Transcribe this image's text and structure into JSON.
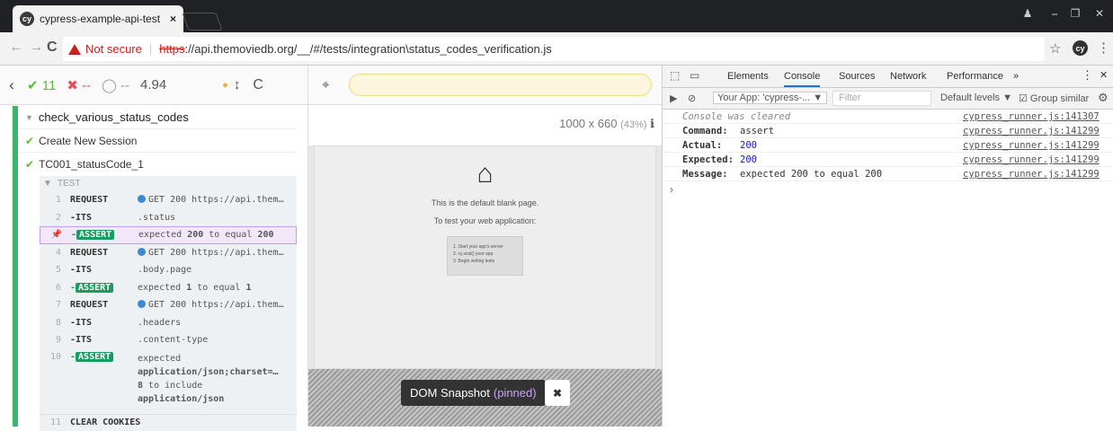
{
  "browser": {
    "tab_title": "cypress-example-api-test",
    "tab_close": "×",
    "favicon_text": "cy",
    "window_controls": [
      "⎯",
      "❐",
      "✕"
    ],
    "nav": {
      "back": "←",
      "forward": "→",
      "reload": "C"
    },
    "not_secure": "Not secure",
    "separator": "|",
    "url_scheme": "https",
    "url_rest": "://api.themoviedb.org/__/#/tests/integration\\status_codes_verification.js",
    "star": "☆",
    "ext_text": "cy",
    "menu": "⋮"
  },
  "reporter": {
    "back": "‹",
    "passed_icon": "✔",
    "passed": "11",
    "failed_icon": "✖",
    "failed": "--",
    "pending_icon": "◯",
    "pending": "--",
    "duration": "4.94",
    "dot": "●",
    "sort": "↕",
    "reload": "C",
    "suite_title": "check_various_status_codes",
    "test1": "Create New Session",
    "test2": "TC001_statusCode_1",
    "section": "TEST",
    "commands": [
      {
        "num": "1",
        "name": "REQUEST",
        "msg": "GET 200 https://api.them…"
      },
      {
        "num": "2",
        "name": "-ITS",
        "msg": ".status"
      },
      {
        "num": "📌",
        "name": "ASSERT",
        "msg_a": "expected ",
        "msg_b": "200",
        "msg_c": " to equal ",
        "msg_d": "200"
      },
      {
        "num": "4",
        "name": "REQUEST",
        "msg": "GET 200 https://api.them…"
      },
      {
        "num": "5",
        "name": "-ITS",
        "msg": ".body.page"
      },
      {
        "num": "6",
        "name": "ASSERT",
        "msg_a": "expected ",
        "msg_b": "1",
        "msg_c": " to equal ",
        "msg_d": "1"
      },
      {
        "num": "7",
        "name": "REQUEST",
        "msg": "GET 200 https://api.them…"
      },
      {
        "num": "8",
        "name": "-ITS",
        "msg": ".headers"
      },
      {
        "num": "9",
        "name": "-ITS",
        "msg": ".content-type"
      },
      {
        "num": "10",
        "name": "ASSERT",
        "msg_a": "expected",
        "msg_b": "application/json;charset=…",
        "msg_c": "8",
        "msg_c2": " to include",
        "msg_d": "application/json"
      },
      {
        "num": "11",
        "name": "CLEAR COOKIES",
        "msg": ""
      }
    ]
  },
  "aut": {
    "crosshair": "⌖",
    "viewport": "1000 x 660",
    "scale": "(43%)",
    "info_icon": "ℹ",
    "home_icon": "⌂",
    "blank_line1": "This is the default blank page.",
    "blank_line2": "To test your web application:",
    "steps": [
      "1. Start your app's server",
      "2. cy.visit() your app",
      "3. Begin writing tests"
    ],
    "snapshot_label": "DOM Snapshot",
    "snapshot_pinned": "(pinned)",
    "snapshot_close": "✖"
  },
  "devtools": {
    "inspect_icon": "⬚",
    "device_icon": "▭",
    "tabs": [
      "Elements",
      "Console",
      "Sources",
      "Network",
      "Performance",
      "»"
    ],
    "kebab": "⋮",
    "close": "✕",
    "sidebar_icon": "▶",
    "clear_icon": "⊘",
    "context": "Your App: 'cypress-... ▼",
    "filter_placeholder": "Filter",
    "levels": "Default levels ▼",
    "group_similar": "☑ Group similar",
    "settings_icon": "⚙",
    "cleared": "Console was cleared",
    "rows": [
      {
        "label": "Command:",
        "value": "assert",
        "src": "cypress_runner.js:141299"
      },
      {
        "label": "Actual:",
        "value": "200",
        "src": "cypress_runner.js:141299"
      },
      {
        "label": "Expected:",
        "value": "200",
        "src": "cypress_runner.js:141299"
      },
      {
        "label": "Message:",
        "value": "expected 200 to equal 200",
        "src": "cypress_runner.js:141299"
      }
    ],
    "cleared_src": "cypress_runner.js:141307",
    "prompt": "›"
  }
}
